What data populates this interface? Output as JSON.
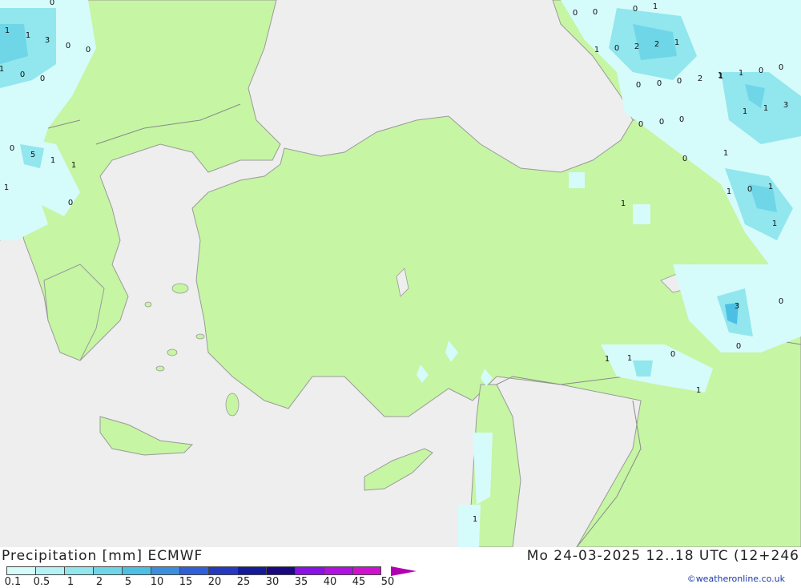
{
  "title": {
    "left": "Precipitation [mm] ECMWF",
    "right": "Mo 24-03-2025 12..18 UTC (12+246"
  },
  "credit": "©weatheronline.co.uk",
  "legend": {
    "ticks": [
      "0.1",
      "0.5",
      "1",
      "2",
      "5",
      "10",
      "15",
      "20",
      "25",
      "30",
      "35",
      "40",
      "45",
      "50"
    ],
    "colors": [
      "#d6fbfb",
      "#b4f2f5",
      "#92e6ee",
      "#6fd6e8",
      "#4cc0e4",
      "#3b8ede",
      "#3060d8",
      "#2438c0",
      "#141b99",
      "#1a0880",
      "#8a10e8",
      "#b010e0",
      "#d010d0",
      "#e010c8"
    ],
    "arrow_color": "#b000b0"
  },
  "map_colors": {
    "sea": "#eeeeee",
    "land": "#c6f5a3",
    "border": "#8a8a8a",
    "coast": "#9a9a9a"
  },
  "values": [
    "0",
    "1",
    "1",
    "3",
    "0",
    "0",
    "1",
    "0",
    "0",
    "0",
    "5",
    "1",
    "1",
    "0",
    "1",
    "0",
    "0",
    "0",
    "1",
    "1",
    "0",
    "2",
    "2",
    "1",
    "0",
    "0",
    "0",
    "2",
    "1",
    "1",
    "0",
    "0",
    "1",
    "1",
    "3",
    "0",
    "0",
    "0",
    "1",
    "0",
    "1",
    "0",
    "1",
    "1",
    "0",
    "1",
    "3",
    "0",
    "1",
    "1",
    "0",
    "1",
    "1",
    "1"
  ]
}
